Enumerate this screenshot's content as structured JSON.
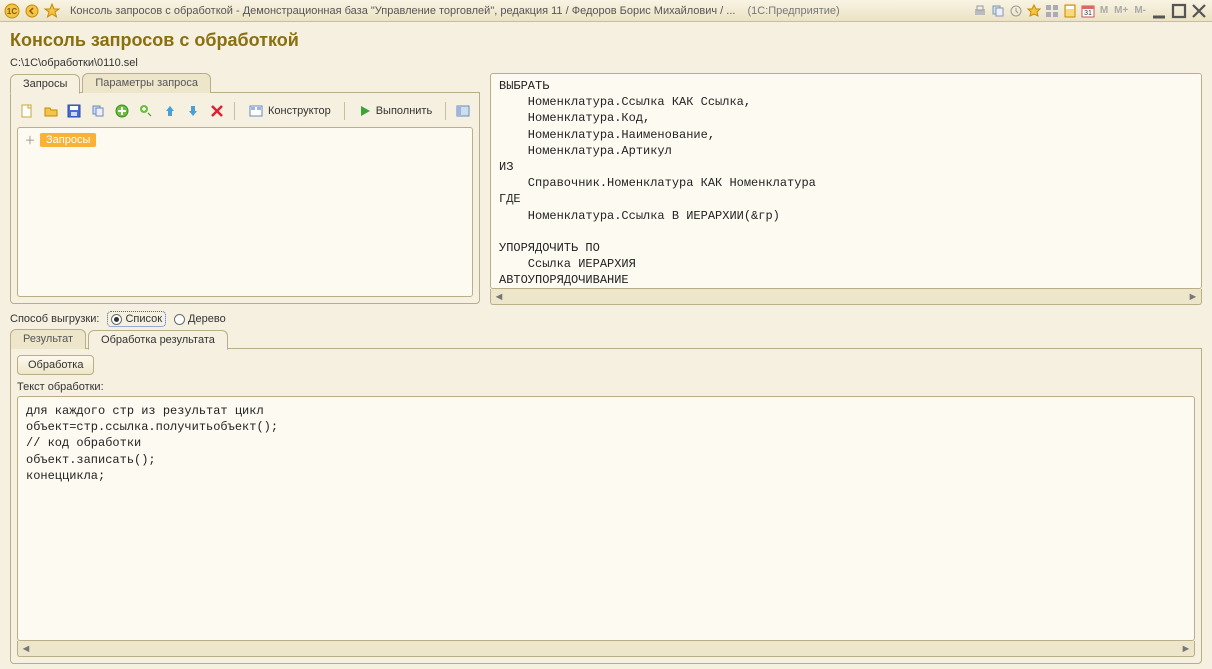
{
  "titlebar": {
    "title": "Консоль запросов с обработкой - Демонстрационная база \"Управление торговлей\", редакция 11 / Федоров Борис Михайлович / ...",
    "suffix": "(1С:Предприятие)",
    "mem": {
      "m": "M",
      "mplus": "M+",
      "mminus": "M-"
    }
  },
  "page": {
    "title": "Консоль запросов с обработкой",
    "file_path": "C:\\1C\\обработки\\0110.sel"
  },
  "tabs_top": {
    "queries": "Запросы",
    "params": "Параметры запроса"
  },
  "toolbar": {
    "constructor": "Конструктор",
    "execute": "Выполнить"
  },
  "tree": {
    "root_label": "Запросы"
  },
  "query_text": "ВЫБРАТЬ\n    Номенклатура.Ссылка КАК Ссылка,\n    Номенклатура.Код,\n    Номенклатура.Наименование,\n    Номенклатура.Артикул\nИЗ\n    Справочник.Номенклатура КАК Номенклатура\nГДЕ\n    Номенклатура.Ссылка В ИЕРАРХИИ(&гр)\n\nУПОРЯДОЧИТЬ ПО\n    Ссылка ИЕРАРХИЯ\nАВТОУПОРЯДОЧИВАНИЕ",
  "export_mode": {
    "label": "Способ выгрузки:",
    "list": "Список",
    "tree": "Дерево",
    "selected": "list"
  },
  "tabs_bottom": {
    "result": "Результат",
    "processing": "Обработка результата"
  },
  "processing": {
    "button": "Обработка",
    "label": "Текст обработки:",
    "code": "для каждого стр из результат цикл\nобъект=стр.ссылка.получитьобъект();\n// код обработки\nобъект.записать();\nконеццикла;"
  }
}
